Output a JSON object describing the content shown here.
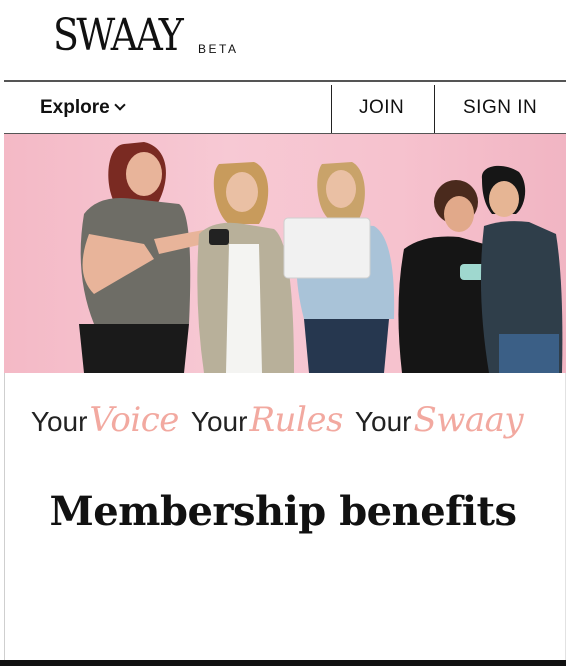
{
  "brand": {
    "logo_text": "SWAAY",
    "beta_label": "BETA"
  },
  "nav": {
    "explore_label": "Explore",
    "join_label": "JOIN",
    "signin_label": "SIGN IN"
  },
  "hero": {
    "background_color": "#f6c2ce"
  },
  "slogan": [
    {
      "word": "Your",
      "script": "Voice"
    },
    {
      "word": "Your",
      "script": "Rules"
    },
    {
      "word": "Your",
      "script": "Swaay"
    }
  ],
  "headline": "Membership benefits",
  "colors": {
    "accent_script": "#f2a9a0",
    "text": "#111111"
  }
}
